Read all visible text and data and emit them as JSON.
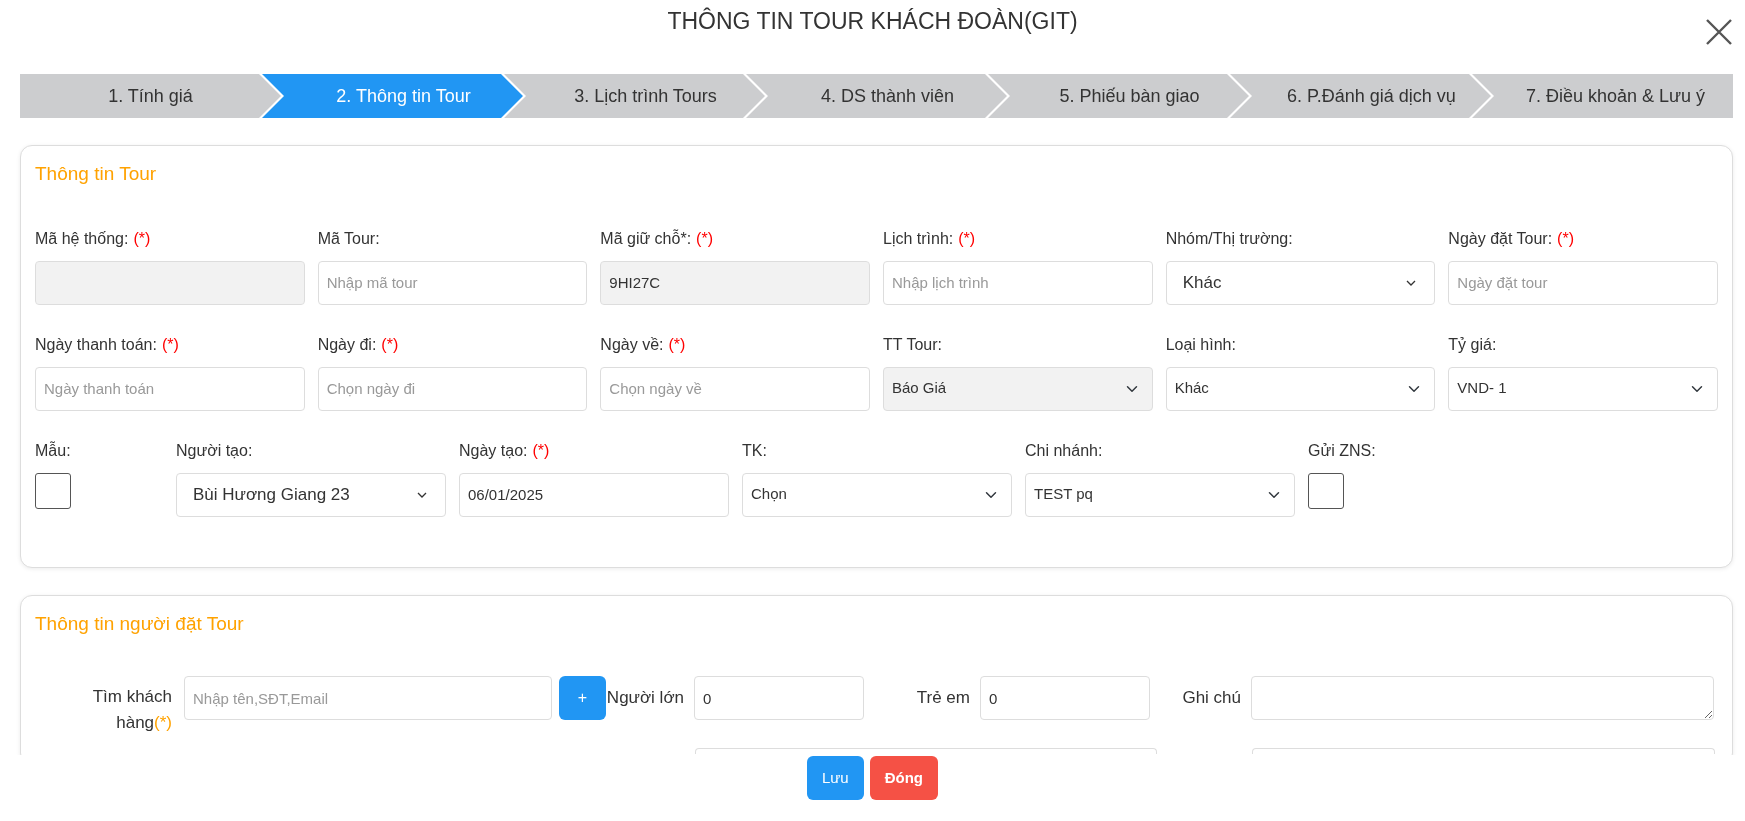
{
  "window": {
    "title": "THÔNG TIN TOUR KHÁCH ĐOÀN(GIT)"
  },
  "steps": [
    {
      "label": "1. Tính giá",
      "selected": false
    },
    {
      "label": "2. Thông tin Tour",
      "selected": true
    },
    {
      "label": "3. Lịch trình Tours",
      "selected": false
    },
    {
      "label": "4. DS thành viên",
      "selected": false
    },
    {
      "label": "5. Phiếu bàn giao",
      "selected": false
    },
    {
      "label": "6. P.Đánh giá dịch vụ",
      "selected": false
    },
    {
      "label": "7. Điều khoản & Lưu ý",
      "selected": false
    }
  ],
  "tour_info": {
    "title": "Thông tin Tour",
    "rows": [
      [
        {
          "kind": "input",
          "label": "Mã hệ thống:",
          "required_mark": "(*)",
          "disabled": true
        },
        {
          "kind": "input",
          "label": "Mã Tour:",
          "placeholder": "Nhập mã tour",
          "disabled": false
        },
        {
          "kind": "input",
          "label": "Mã giữ chỗ*:",
          "required_mark": "(*)",
          "value": "9HI27C",
          "disabled": true
        },
        {
          "kind": "input",
          "label": "Lịch trình:",
          "required_mark": "(*)",
          "placeholder": "Nhập lịch trình",
          "disabled": false
        },
        {
          "kind": "combo",
          "label": "Nhóm/Thị trường:",
          "value": "Khác",
          "disabled": false
        },
        {
          "kind": "input",
          "label": "Ngày đặt Tour:",
          "required_mark": "(*)",
          "placeholder": "Ngày đặt tour",
          "disabled": false
        }
      ],
      [
        {
          "kind": "input",
          "label": "Ngày thanh toán:",
          "required_mark": "(*)",
          "placeholder": "Ngày thanh toán",
          "disabled": false
        },
        {
          "kind": "input",
          "label": "Ngày đi:",
          "required_mark": "(*)",
          "placeholder": "Chọn ngày đi",
          "disabled": false
        },
        {
          "kind": "input",
          "label": "Ngày về:",
          "required_mark": "(*)",
          "placeholder": "Chọn ngày về",
          "disabled": false
        },
        {
          "kind": "select",
          "label": "TT Tour:",
          "value": "Báo Giá",
          "disabled": true
        },
        {
          "kind": "select",
          "label": "Loại hình:",
          "value": "Khác",
          "disabled": false
        },
        {
          "kind": "select",
          "label": "Tỷ giá:",
          "value": "VND- 1",
          "disabled": false
        }
      ],
      [
        {
          "kind": "checkbox",
          "label": "Mẫu:",
          "checked": false
        },
        {
          "kind": "combo",
          "label": "Người tạo:",
          "value": "Bùi Hương Giang 23",
          "disabled": false
        },
        {
          "kind": "input",
          "label": "Ngày tạo:",
          "required_mark": "(*)",
          "value": "06/01/2025",
          "disabled": false
        },
        {
          "kind": "select",
          "label": "TK:",
          "value": "Chọn",
          "disabled": false
        },
        {
          "kind": "select",
          "label": "Chi nhánh:",
          "value": "TEST pq",
          "disabled": false
        },
        {
          "kind": "checkbox",
          "label": "Gửi ZNS:",
          "checked": false
        }
      ]
    ]
  },
  "booker": {
    "title": "Thông tin người đặt Tour",
    "search": {
      "label": "Tìm khách hàng",
      "required_mark": "(*)",
      "placeholder": "Nhập tên,SĐT,Email",
      "add_button": "+"
    },
    "adults": {
      "label": "Người lớn",
      "value": "0"
    },
    "children": {
      "label": "Trẻ em",
      "value": "0"
    },
    "note": {
      "label": "Ghi chú"
    }
  },
  "buttons": [
    {
      "label": "Lưu",
      "kind": "primary"
    },
    {
      "label": "Đóng",
      "kind": "danger"
    }
  ]
}
